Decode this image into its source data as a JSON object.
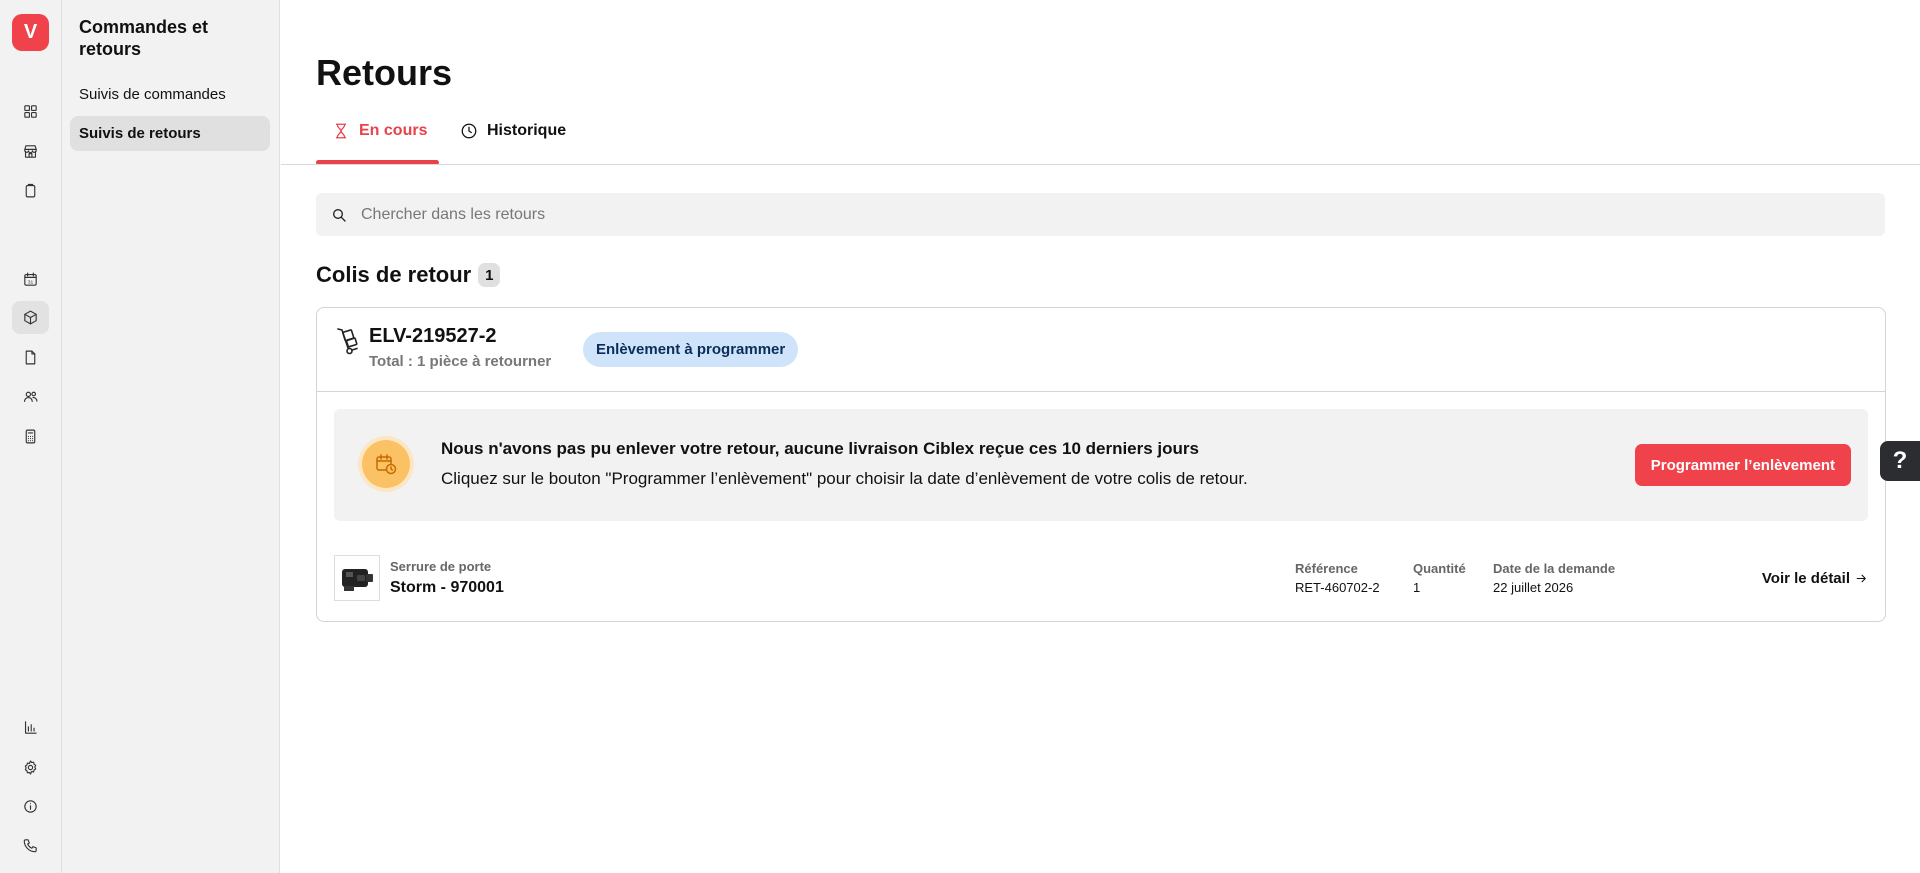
{
  "app": {
    "logo_letter": "V"
  },
  "rail": {
    "items": [
      {
        "icon": "dashboard-icon"
      },
      {
        "icon": "store-icon"
      },
      {
        "icon": "clipboard-icon"
      },
      {
        "icon": "calendar-icon",
        "label": "31"
      },
      {
        "icon": "package-icon",
        "active": true
      },
      {
        "icon": "document-icon"
      },
      {
        "icon": "users-icon"
      },
      {
        "icon": "calculator-icon"
      },
      {
        "icon": "bar-chart-icon"
      },
      {
        "icon": "gear-icon"
      },
      {
        "icon": "info-icon"
      },
      {
        "icon": "phone-icon"
      }
    ]
  },
  "subnav": {
    "title": "Commandes et retours",
    "items": [
      {
        "label": "Suivis de commandes",
        "active": false
      },
      {
        "label": "Suivis de retours",
        "active": true
      }
    ]
  },
  "page": {
    "title": "Retours",
    "tabs": [
      {
        "label": "En cours",
        "icon": "hourglass-icon",
        "active": true
      },
      {
        "label": "Historique",
        "icon": "clock-icon",
        "active": false
      }
    ],
    "search": {
      "placeholder": "Chercher dans les retours",
      "value": ""
    }
  },
  "section": {
    "title": "Colis de retour",
    "count": "1"
  },
  "parcel": {
    "id": "ELV-219527-2",
    "total": "Total : 1 pièce à retourner",
    "status": "Enlèvement à programmer",
    "alert": {
      "title": "Nous n'avons pas pu enlever votre retour, aucune livraison Ciblex reçue ces 10 derniers jours",
      "text": "Cliquez sur le bouton \"Programmer l’enlèvement\" pour choisir la date d’enlèvement de votre colis de retour.",
      "cta": "Programmer l’enlèvement"
    },
    "item": {
      "category": "Serrure de porte",
      "name": "Storm - 970001",
      "reference_label": "Référence",
      "reference": "RET-460702-2",
      "quantity_label": "Quantité",
      "quantity": "1",
      "date_label": "Date de la demande",
      "date": "22 juillet 2026",
      "detail_link": "Voir le détail"
    }
  },
  "help": {
    "label": "?"
  },
  "colors": {
    "accent": "#f0424b",
    "badge_bg": "#cfe4fb",
    "badge_text": "#0c2d57",
    "alert_icon": "#fbc165"
  }
}
